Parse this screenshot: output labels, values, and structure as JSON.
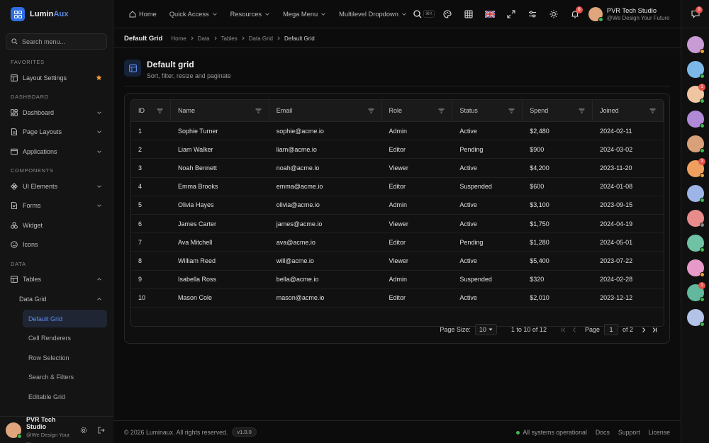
{
  "brand": {
    "name_a": "Lumin",
    "name_b": "Aux"
  },
  "sidebar": {
    "search_placeholder": "Search menu...",
    "sections": {
      "favorites": "FAVORITES",
      "dashboard": "DASHBOARD",
      "components": "COMPONENTS",
      "data": "DATA"
    },
    "items": {
      "layout_settings": "Layout Settings",
      "dashboard": "Dashboard",
      "page_layouts": "Page Layouts",
      "applications": "Applications",
      "ui_elements": "UI Elements",
      "forms": "Forms",
      "widget": "Widget",
      "icons": "Icons",
      "tables": "Tables",
      "data_grid": "Data Grid"
    },
    "data_grid_children": [
      "Default Grid",
      "Cell Renderers",
      "Row Selection",
      "Search & Filters",
      "Editable Grid"
    ],
    "footer": {
      "name": "PVR Tech Studio",
      "subtitle": "@We Design Your ..."
    }
  },
  "topbar": {
    "nav": [
      "Home",
      "Quick Access",
      "Resources",
      "Mega Menu",
      "Multilevel Dropdown"
    ],
    "search_kbd": "⌘K",
    "notification_count": "6",
    "profile": {
      "name": "PVR Tech Studio",
      "subtitle": "@We Design Your Future"
    }
  },
  "rail": {
    "chat_badge": "9",
    "badges": [
      "1",
      "3",
      "1"
    ]
  },
  "breadcrumb": {
    "title": "Default Grid",
    "path": [
      "Home",
      "Data",
      "Tables",
      "Data Grid",
      "Default Grid"
    ]
  },
  "page": {
    "title": "Default grid",
    "subtitle": "Sort, filter, resize and paginate"
  },
  "grid": {
    "columns": [
      "ID",
      "Name",
      "Email",
      "Role",
      "Status",
      "Spend",
      "Joined"
    ],
    "rows": [
      [
        "1",
        "Sophie Turner",
        "sophie@acme.io",
        "Admin",
        "Active",
        "$2,480",
        "2024-02-11"
      ],
      [
        "2",
        "Liam Walker",
        "liam@acme.io",
        "Editor",
        "Pending",
        "$900",
        "2024-03-02"
      ],
      [
        "3",
        "Noah Bennett",
        "noah@acme.io",
        "Viewer",
        "Active",
        "$4,200",
        "2023-11-20"
      ],
      [
        "4",
        "Emma Brooks",
        "emma@acme.io",
        "Editor",
        "Suspended",
        "$600",
        "2024-01-08"
      ],
      [
        "5",
        "Olivia Hayes",
        "olivia@acme.io",
        "Admin",
        "Active",
        "$3,100",
        "2023-09-15"
      ],
      [
        "6",
        "James Carter",
        "james@acme.io",
        "Viewer",
        "Active",
        "$1,750",
        "2024-04-19"
      ],
      [
        "7",
        "Ava Mitchell",
        "ava@acme.io",
        "Editor",
        "Pending",
        "$1,280",
        "2024-05-01"
      ],
      [
        "8",
        "William Reed",
        "will@acme.io",
        "Viewer",
        "Active",
        "$5,400",
        "2023-07-22"
      ],
      [
        "9",
        "Isabella Ross",
        "bella@acme.io",
        "Admin",
        "Suspended",
        "$320",
        "2024-02-28"
      ],
      [
        "10",
        "Mason Cole",
        "mason@acme.io",
        "Editor",
        "Active",
        "$2,010",
        "2023-12-12"
      ]
    ],
    "pager": {
      "page_size_label": "Page Size:",
      "page_size": "10",
      "range": "1 to 10 of 12",
      "page_label": "Page",
      "page": "1",
      "of": "of 2"
    }
  },
  "footer": {
    "copyright": "© 2026 Luminaux. All rights reserved.",
    "version": "v1.0.0",
    "status": "All systems operational",
    "links": [
      "Docs",
      "Support",
      "License"
    ]
  },
  "colors": {
    "accent": "#5b8def",
    "online": "#3fb950",
    "away": "#f2a33a",
    "badge": "#e5534b"
  }
}
